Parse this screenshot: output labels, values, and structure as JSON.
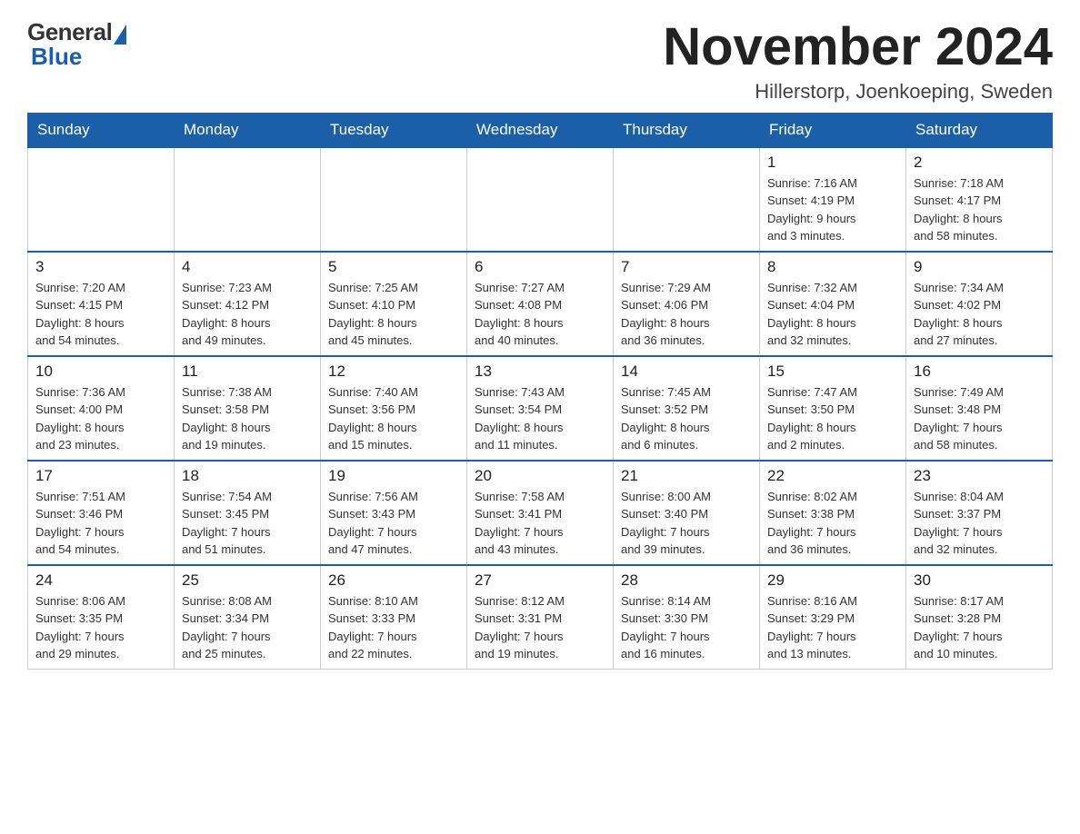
{
  "header": {
    "month_title": "November 2024",
    "location": "Hillerstorp, Joenkoeping, Sweden"
  },
  "days_of_week": [
    "Sunday",
    "Monday",
    "Tuesday",
    "Wednesday",
    "Thursday",
    "Friday",
    "Saturday"
  ],
  "weeks": [
    [
      {
        "day": "",
        "info": ""
      },
      {
        "day": "",
        "info": ""
      },
      {
        "day": "",
        "info": ""
      },
      {
        "day": "",
        "info": ""
      },
      {
        "day": "",
        "info": ""
      },
      {
        "day": "1",
        "info": "Sunrise: 7:16 AM\nSunset: 4:19 PM\nDaylight: 9 hours\nand 3 minutes."
      },
      {
        "day": "2",
        "info": "Sunrise: 7:18 AM\nSunset: 4:17 PM\nDaylight: 8 hours\nand 58 minutes."
      }
    ],
    [
      {
        "day": "3",
        "info": "Sunrise: 7:20 AM\nSunset: 4:15 PM\nDaylight: 8 hours\nand 54 minutes."
      },
      {
        "day": "4",
        "info": "Sunrise: 7:23 AM\nSunset: 4:12 PM\nDaylight: 8 hours\nand 49 minutes."
      },
      {
        "day": "5",
        "info": "Sunrise: 7:25 AM\nSunset: 4:10 PM\nDaylight: 8 hours\nand 45 minutes."
      },
      {
        "day": "6",
        "info": "Sunrise: 7:27 AM\nSunset: 4:08 PM\nDaylight: 8 hours\nand 40 minutes."
      },
      {
        "day": "7",
        "info": "Sunrise: 7:29 AM\nSunset: 4:06 PM\nDaylight: 8 hours\nand 36 minutes."
      },
      {
        "day": "8",
        "info": "Sunrise: 7:32 AM\nSunset: 4:04 PM\nDaylight: 8 hours\nand 32 minutes."
      },
      {
        "day": "9",
        "info": "Sunrise: 7:34 AM\nSunset: 4:02 PM\nDaylight: 8 hours\nand 27 minutes."
      }
    ],
    [
      {
        "day": "10",
        "info": "Sunrise: 7:36 AM\nSunset: 4:00 PM\nDaylight: 8 hours\nand 23 minutes."
      },
      {
        "day": "11",
        "info": "Sunrise: 7:38 AM\nSunset: 3:58 PM\nDaylight: 8 hours\nand 19 minutes."
      },
      {
        "day": "12",
        "info": "Sunrise: 7:40 AM\nSunset: 3:56 PM\nDaylight: 8 hours\nand 15 minutes."
      },
      {
        "day": "13",
        "info": "Sunrise: 7:43 AM\nSunset: 3:54 PM\nDaylight: 8 hours\nand 11 minutes."
      },
      {
        "day": "14",
        "info": "Sunrise: 7:45 AM\nSunset: 3:52 PM\nDaylight: 8 hours\nand 6 minutes."
      },
      {
        "day": "15",
        "info": "Sunrise: 7:47 AM\nSunset: 3:50 PM\nDaylight: 8 hours\nand 2 minutes."
      },
      {
        "day": "16",
        "info": "Sunrise: 7:49 AM\nSunset: 3:48 PM\nDaylight: 7 hours\nand 58 minutes."
      }
    ],
    [
      {
        "day": "17",
        "info": "Sunrise: 7:51 AM\nSunset: 3:46 PM\nDaylight: 7 hours\nand 54 minutes."
      },
      {
        "day": "18",
        "info": "Sunrise: 7:54 AM\nSunset: 3:45 PM\nDaylight: 7 hours\nand 51 minutes."
      },
      {
        "day": "19",
        "info": "Sunrise: 7:56 AM\nSunset: 3:43 PM\nDaylight: 7 hours\nand 47 minutes."
      },
      {
        "day": "20",
        "info": "Sunrise: 7:58 AM\nSunset: 3:41 PM\nDaylight: 7 hours\nand 43 minutes."
      },
      {
        "day": "21",
        "info": "Sunrise: 8:00 AM\nSunset: 3:40 PM\nDaylight: 7 hours\nand 39 minutes."
      },
      {
        "day": "22",
        "info": "Sunrise: 8:02 AM\nSunset: 3:38 PM\nDaylight: 7 hours\nand 36 minutes."
      },
      {
        "day": "23",
        "info": "Sunrise: 8:04 AM\nSunset: 3:37 PM\nDaylight: 7 hours\nand 32 minutes."
      }
    ],
    [
      {
        "day": "24",
        "info": "Sunrise: 8:06 AM\nSunset: 3:35 PM\nDaylight: 7 hours\nand 29 minutes."
      },
      {
        "day": "25",
        "info": "Sunrise: 8:08 AM\nSunset: 3:34 PM\nDaylight: 7 hours\nand 25 minutes."
      },
      {
        "day": "26",
        "info": "Sunrise: 8:10 AM\nSunset: 3:33 PM\nDaylight: 7 hours\nand 22 minutes."
      },
      {
        "day": "27",
        "info": "Sunrise: 8:12 AM\nSunset: 3:31 PM\nDaylight: 7 hours\nand 19 minutes."
      },
      {
        "day": "28",
        "info": "Sunrise: 8:14 AM\nSunset: 3:30 PM\nDaylight: 7 hours\nand 16 minutes."
      },
      {
        "day": "29",
        "info": "Sunrise: 8:16 AM\nSunset: 3:29 PM\nDaylight: 7 hours\nand 13 minutes."
      },
      {
        "day": "30",
        "info": "Sunrise: 8:17 AM\nSunset: 3:28 PM\nDaylight: 7 hours\nand 10 minutes."
      }
    ]
  ]
}
